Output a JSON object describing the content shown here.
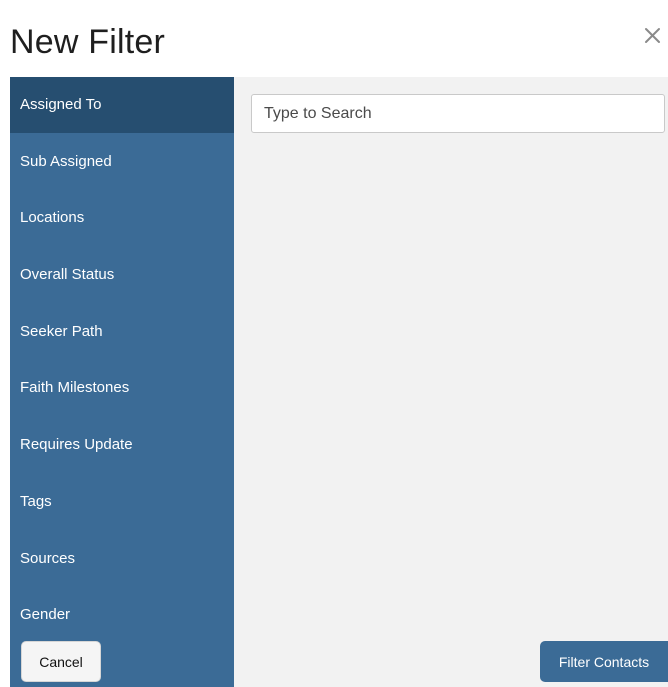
{
  "modal": {
    "title": "New Filter",
    "close_icon": "close-icon"
  },
  "sidebar": {
    "active_index": 0,
    "items": [
      {
        "label": "Assigned To"
      },
      {
        "label": "Sub Assigned"
      },
      {
        "label": "Locations"
      },
      {
        "label": "Overall Status"
      },
      {
        "label": "Seeker Path"
      },
      {
        "label": "Faith Milestones"
      },
      {
        "label": "Requires Update"
      },
      {
        "label": "Tags"
      },
      {
        "label": "Sources"
      },
      {
        "label": "Gender"
      }
    ]
  },
  "search": {
    "placeholder": "Type to Search",
    "value": ""
  },
  "footer": {
    "cancel_label": "Cancel",
    "filter_label": "Filter Contacts"
  },
  "colors": {
    "sidebar_bg": "#3b6b96",
    "sidebar_active_bg": "#264e70",
    "content_bg": "#f2f2f2",
    "primary_button": "#3b6b96"
  }
}
